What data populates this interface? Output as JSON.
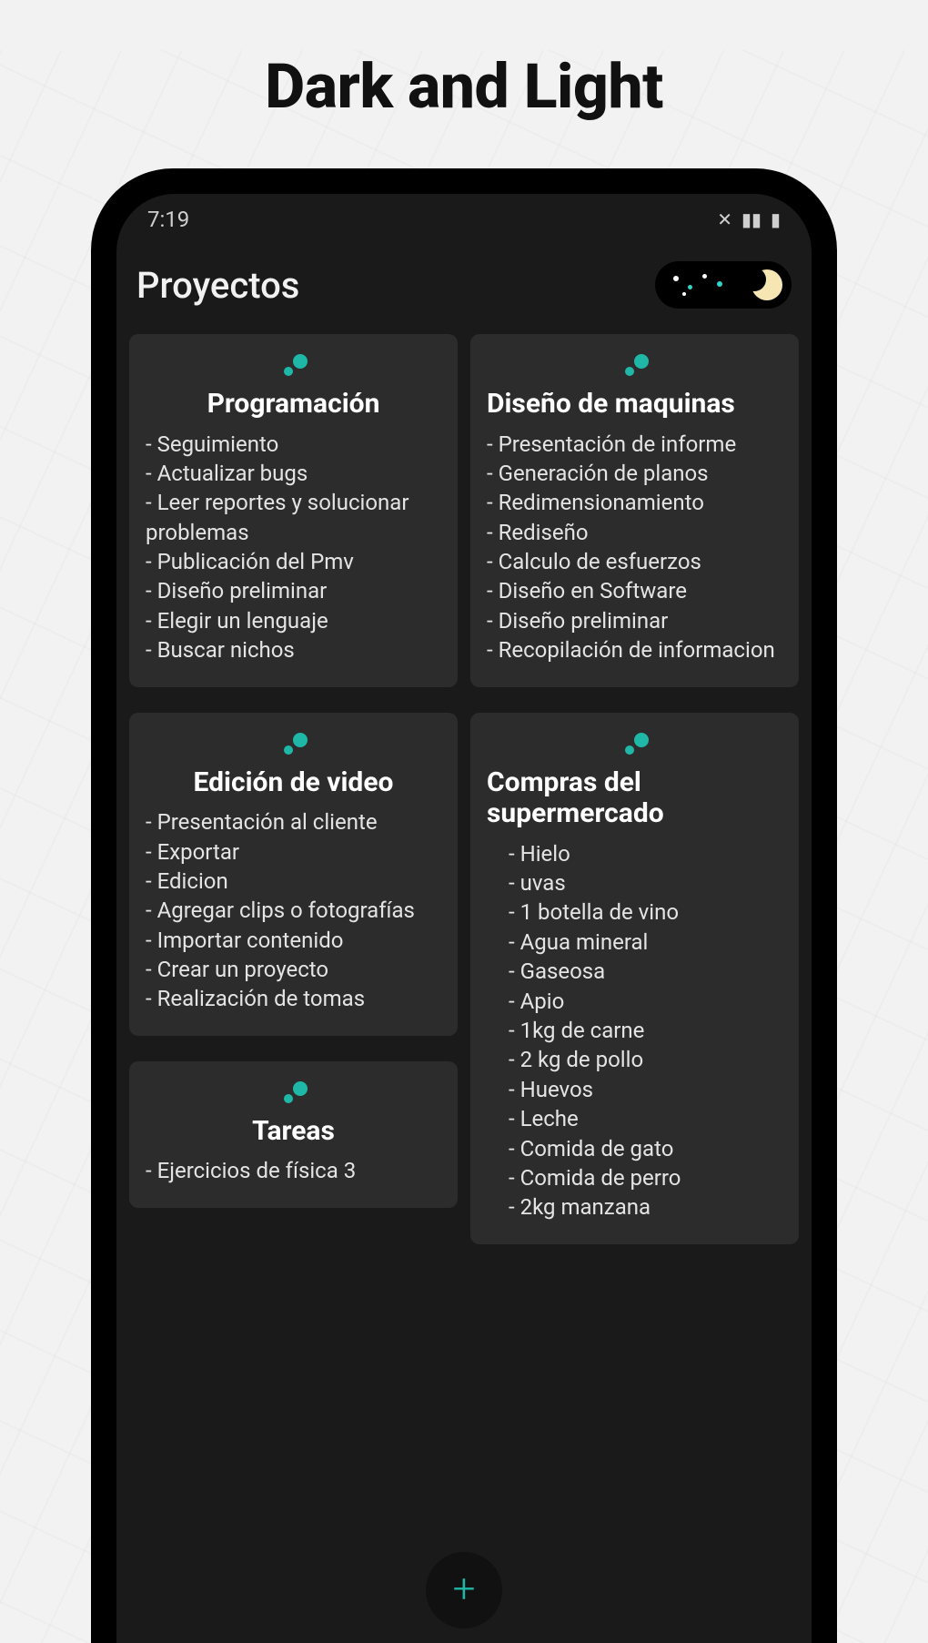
{
  "marketing_title": "Dark and Light",
  "status": {
    "time": "7:19"
  },
  "header": {
    "title": "Proyectos"
  },
  "fab": {
    "glyph": "+"
  },
  "cards_left": [
    {
      "title": "Programación",
      "items": [
        "Seguimiento",
        "Actualizar bugs",
        "Leer reportes y solucionar problemas",
        "Publicación del Pmv",
        "Diseño preliminar",
        "Elegir un lenguaje",
        "Buscar nichos"
      ]
    },
    {
      "title": "Edición de video",
      "items": [
        "Presentación al cliente",
        "Exportar",
        "Edicion",
        "Agregar clips o fotografías",
        "Importar contenido",
        "Crear un proyecto",
        "Realización de tomas"
      ]
    },
    {
      "title": "Tareas",
      "items": [
        "Ejercicios de física 3"
      ]
    }
  ],
  "cards_right": [
    {
      "title": "Diseño de maquinas",
      "items": [
        "Presentación de informe",
        "Generación de planos",
        "Redimensionamiento",
        "Rediseño",
        "Calculo de esfuerzos",
        "Diseño en Software",
        "Diseño preliminar",
        "Recopilación de informacion"
      ]
    },
    {
      "title": "Compras del supermercado",
      "indent": true,
      "items": [
        "Hielo",
        "uvas",
        "1 botella de vino",
        "Agua mineral",
        "Gaseosa",
        "Apio",
        "1kg  de carne",
        "2 kg de pollo",
        "Huevos",
        "Leche",
        "Comida de gato",
        "Comida de perro",
        "2kg manzana"
      ]
    }
  ]
}
